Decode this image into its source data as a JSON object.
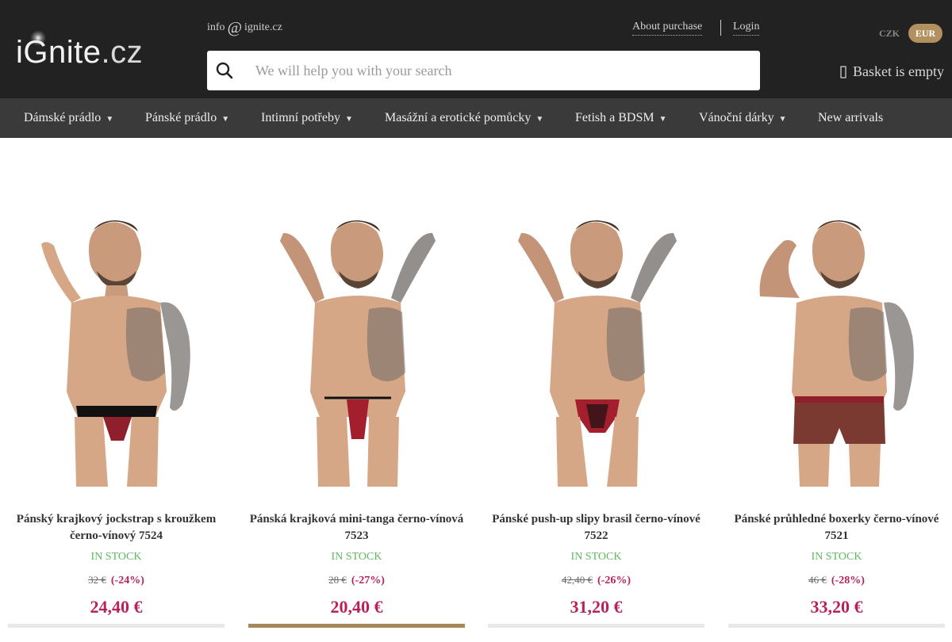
{
  "header": {
    "logo": {
      "brand": "iGnite",
      "tld": ".cz"
    },
    "email": {
      "user": "info",
      "at": "@",
      "domain": "ignite.cz"
    },
    "links": {
      "about": "About purchase",
      "login": "Login"
    },
    "currency": {
      "options": [
        "CZK",
        "EUR"
      ],
      "selected": "EUR"
    },
    "search": {
      "placeholder": "We will help you with your search",
      "value": ""
    },
    "basket": {
      "label": "Basket is empty"
    }
  },
  "nav": {
    "items": [
      {
        "label": "Dámské prádlo",
        "dropdown": true
      },
      {
        "label": "Pánské prádlo",
        "dropdown": true
      },
      {
        "label": "Intimní potřeby",
        "dropdown": true
      },
      {
        "label": "Masážní a erotické pomůcky",
        "dropdown": true
      },
      {
        "label": "Fetish a BDSM",
        "dropdown": true
      },
      {
        "label": "Vánoční dárky",
        "dropdown": true
      },
      {
        "label": "New arrivals",
        "dropdown": false
      }
    ],
    "caret": "▼"
  },
  "products": [
    {
      "title": "Pánský krajkový jockstrap s kroužkem černo-vínový 7524",
      "stock": "IN STOCK",
      "old_price": "32 €",
      "discount": "(-24%)",
      "price": "24,40 €"
    },
    {
      "title": "Pánská krajková mini-tanga černo-vínová 7523",
      "stock": "IN STOCK",
      "old_price": "28 €",
      "discount": "(-27%)",
      "price": "20,40 €"
    },
    {
      "title": "Pánské push-up slipy brasil černo-vínové 7522",
      "stock": "IN STOCK",
      "old_price": "42,40 €",
      "discount": "(-26%)",
      "price": "31,20 €"
    },
    {
      "title": "Pánské průhledné boxerky černo-vínové 7521",
      "stock": "IN STOCK",
      "old_price": "46 €",
      "discount": "(-28%)",
      "price": "33,20 €"
    }
  ],
  "colors": {
    "header_bg": "#222222",
    "nav_bg": "#3a3a3a",
    "accent_gold": "#b39060",
    "price_red": "#b8215a",
    "stock_green": "#5fb95f"
  },
  "icons": {
    "search": "search-icon",
    "basket": "basket-icon"
  }
}
